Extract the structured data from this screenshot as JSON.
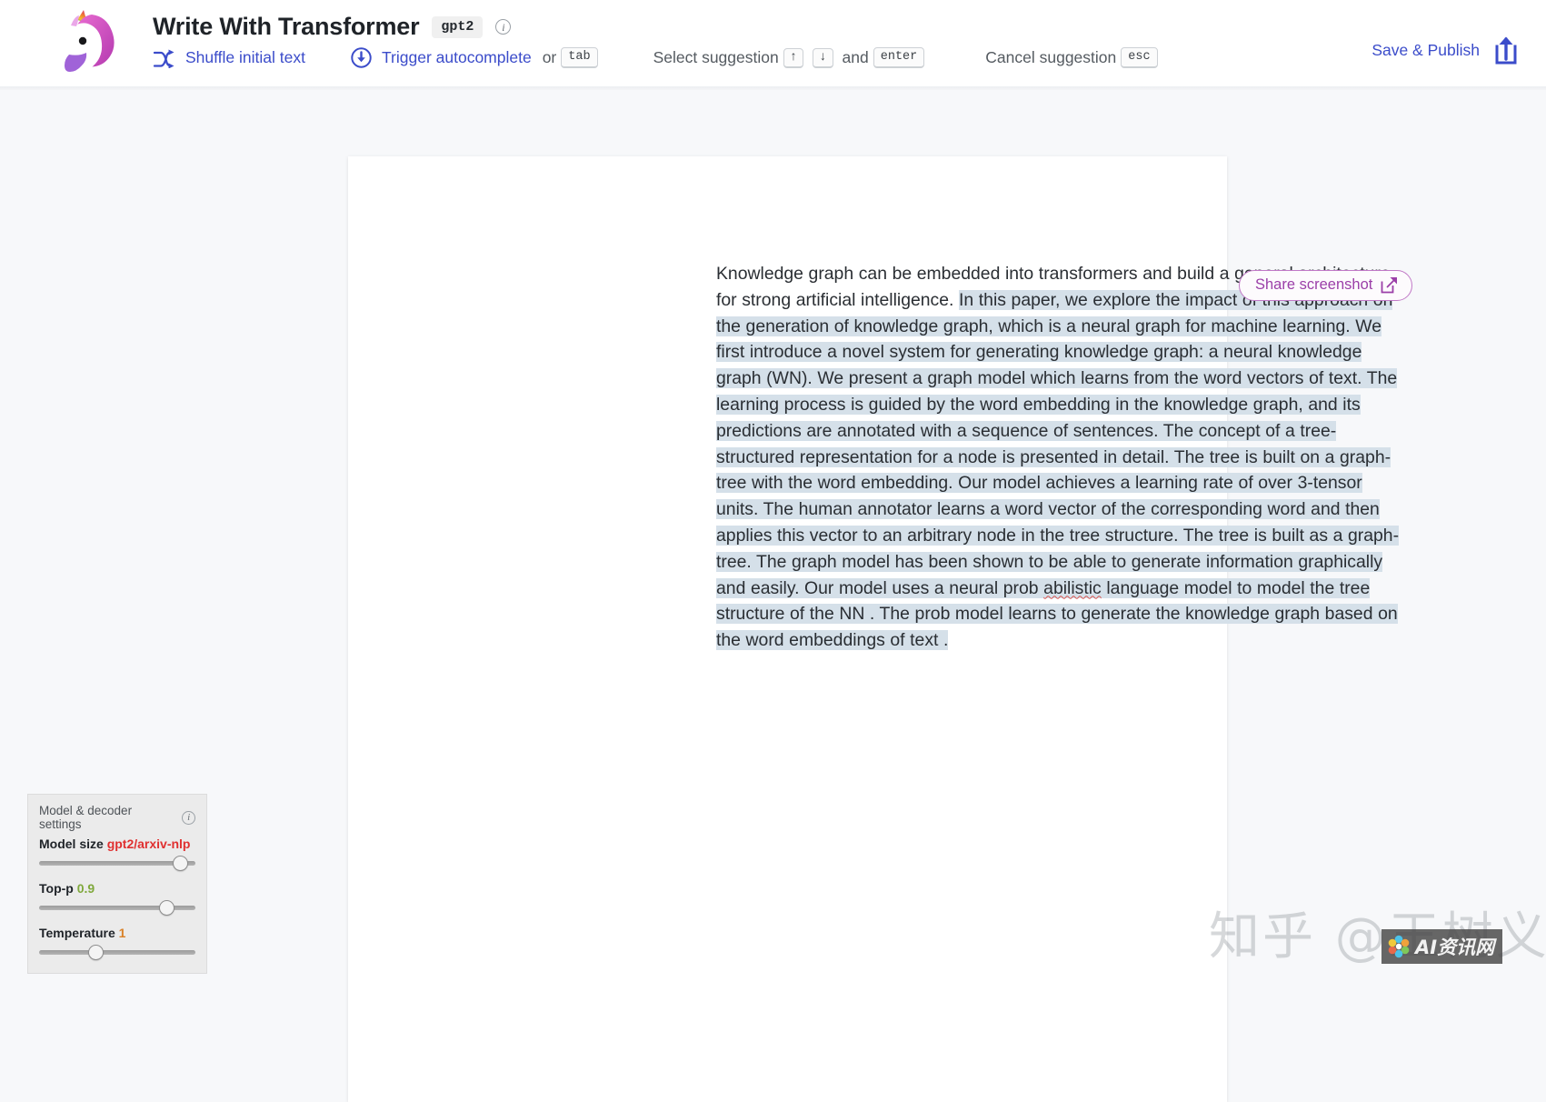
{
  "header": {
    "logo_icon": "unicorn-emoji",
    "app_title": "Write With Transformer",
    "model_badge": "gpt2",
    "info_icon": "info-icon",
    "actions": {
      "shuffle": {
        "icon": "shuffle-icon",
        "label": "Shuffle initial text"
      },
      "autocomplete": {
        "icon": "download-circle-icon",
        "label": "Trigger autocomplete",
        "connector": "or",
        "key": "tab"
      },
      "select_suggestion": {
        "label": "Select suggestion",
        "key_up": "↑",
        "key_down": "↓",
        "connector": "and",
        "key_enter": "enter"
      },
      "cancel_suggestion": {
        "label": "Cancel suggestion",
        "key": "esc"
      }
    },
    "save_publish": {
      "label": "Save & Publish",
      "icon": "share-upload-icon"
    }
  },
  "document": {
    "paragraph": {
      "plain_prefix": "Knowledge graph can be embedded into transformers and build a general architecture for strong artificial intelligence. ",
      "generated_part_1": " In this paper, we explore the impact of this approach on the generation of knowledge graph, which is a neural graph for machine learning. We first introduce a novel system for generating knowledge graph: a neural knowledge graph (WN).  We present a graph model which learns from the word vectors of text. The learning process is guided by the word embedding in the knowledge graph, and its predictions are annotated with  a sequence of sentences. The concept of a tree-structured representation for a node is presented in detail. The tree is built on a graph-tree with the word embedding. Our model achieves a learning rate of over 3-tensor units. The human annotator learns a word vector of the corresponding  word and then applies this vector to an arbitrary node in the tree structure. The tree is built as a graph-tree. The graph model has been shown to be able to generate information graphically and easily. Our model uses a neural prob ",
      "misspelled_word": "abilistic",
      "generated_part_2": " language model to model the tree structure of the NN . The prob model learns  to generate the knowledge graph based on the word embeddings of text ."
    },
    "full_text": "Knowledge graph can be embedded into transformers and build a general architecture for strong artificial intelligence.  In this paper, we explore the impact of this approach on the generation of knowledge graph, which is a neural graph for machine learning. We first introduce a novel system for generating knowledge graph: a neural knowledge graph (WN).  We present a graph model which learns from the word vectors of text. The learning process is guided by the word embedding in the knowledge graph, and its predictions are annotated with  a sequence of sentences. The concept of a tree-structured representation for a node is presented in detail. The tree is built on a graph-tree with the word embedding. Our model achieves a learning rate of over 3-tensor units. The human annotator learns a word vector of the corresponding  word and then applies this vector to an arbitrary node in the tree structure. The tree is built as a graph-tree. The graph model has been shown to be able to generate information graphically and easily. Our model uses a neural prob abilistic language model to model the tree structure of the NN . The prob model learns  to generate the knowledge graph based on the word embeddings of text ."
  },
  "share": {
    "label": "Share screenshot",
    "icon": "external-link-icon"
  },
  "settings": {
    "title": "Model & decoder settings",
    "info_icon": "info-icon",
    "controls": [
      {
        "label": "Model size",
        "value": "gpt2/arxiv-nlp",
        "value_color": "#e03030",
        "thumb_percent": 95
      },
      {
        "label": "Top-p",
        "value": "0.9",
        "value_color": "#7fa83b",
        "thumb_percent": 85
      },
      {
        "label": "Temperature",
        "value": "1",
        "value_color": "#d98127",
        "thumb_percent": 35
      }
    ]
  },
  "watermark": {
    "text": "知乎 @王树义",
    "badge_text": "AI资讯网",
    "badge_icon": "flower-logo-icon"
  },
  "colors": {
    "accent_blue": "#3b4cca",
    "accent_purple": "#9b3fa8",
    "highlight": "#d5e0e9",
    "page_bg": "#f7f8fa"
  }
}
